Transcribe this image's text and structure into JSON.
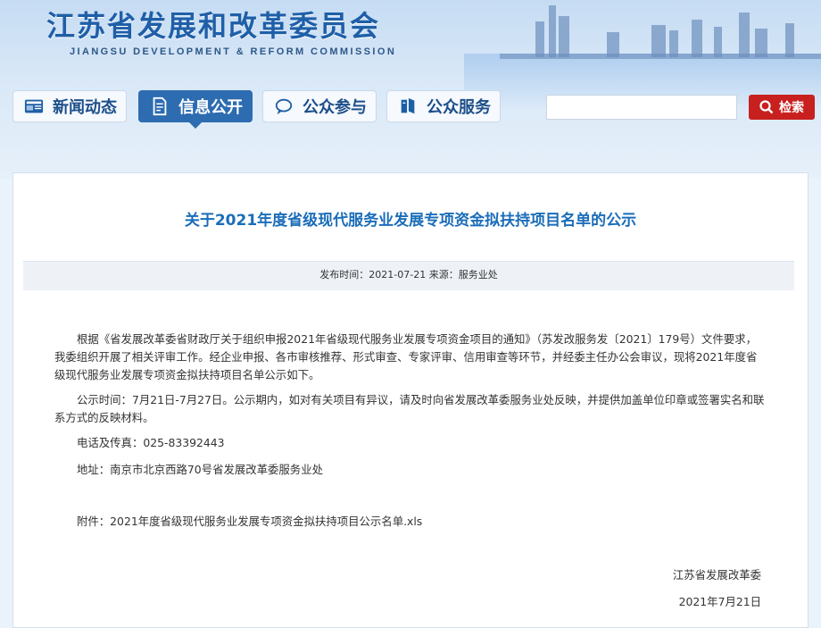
{
  "header": {
    "title": "江苏省发展和改革委员会",
    "subtitle": "JIANGSU DEVELOPMENT & REFORM COMMISSION"
  },
  "nav": [
    {
      "label": "新闻动态",
      "icon": "news-icon"
    },
    {
      "label": "信息公开",
      "icon": "document-icon",
      "active": true
    },
    {
      "label": "公众参与",
      "icon": "chat-icon"
    },
    {
      "label": "公众服务",
      "icon": "book-icon"
    }
  ],
  "search": {
    "placeholder": "",
    "button_label": "检索"
  },
  "article": {
    "title": "关于2021年度省级现代服务业发展专项资金拟扶持项目名单的公示",
    "meta": "发布时间：2021-07-21 来源：服务业处",
    "paragraphs": [
      "根据《省发展改革委省财政厅关于组织申报2021年省级现代服务业发展专项资金项目的通知》（苏发改服务发〔2021〕179号）文件要求，我委组织开展了相关评审工作。经企业申报、各市审核推荐、形式审查、专家评审、信用审查等环节，并经委主任办公会审议，现将2021年度省级现代服务业发展专项资金拟扶持项目名单公示如下。",
      "公示时间：7月21日-7月27日。公示期内，如对有关项目有异议，请及时向省发展改革委服务业处反映，并提供加盖单位印章或签署实名和联系方式的反映材料。",
      "电话及传真：025-83392443",
      "地址：南京市北京西路70号省发展改革委服务业处",
      "附件：2021年度省级现代服务业发展专项资金拟扶持项目公示名单.xls"
    ],
    "signature": "江苏省发展改革委",
    "date": "2021年7月21日"
  }
}
